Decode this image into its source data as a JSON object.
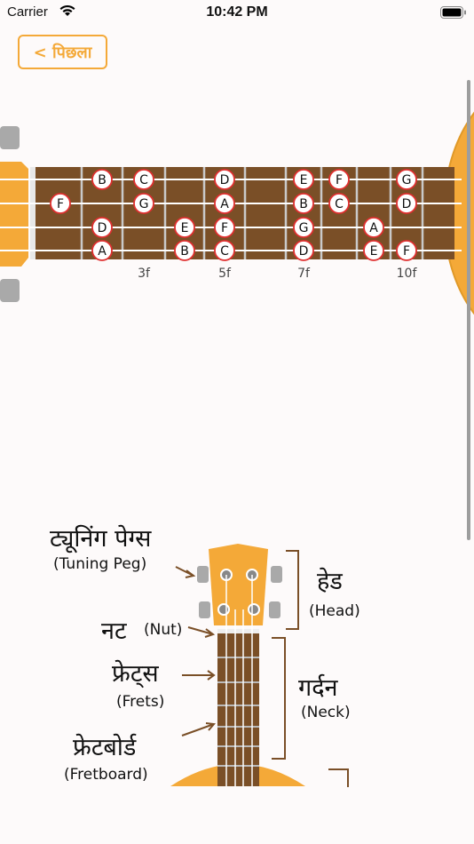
{
  "status_bar": {
    "carrier": "Carrier",
    "time": "10:42 PM"
  },
  "nav": {
    "back_label": "< पिछला"
  },
  "fretboard": {
    "note_markers": [
      {
        "fret": 1,
        "string": 1,
        "label": "B"
      },
      {
        "fret": 2,
        "string": 1,
        "label": "C"
      },
      {
        "fret": 4,
        "string": 1,
        "label": "D"
      },
      {
        "fret": 6,
        "string": 1,
        "label": "E"
      },
      {
        "fret": 7,
        "string": 1,
        "label": "F"
      },
      {
        "fret": 9,
        "string": 1,
        "label": "G"
      },
      {
        "fret": 0,
        "string": 2,
        "label": "F"
      },
      {
        "fret": 2,
        "string": 2,
        "label": "G"
      },
      {
        "fret": 4,
        "string": 2,
        "label": "A"
      },
      {
        "fret": 6,
        "string": 2,
        "label": "B"
      },
      {
        "fret": 7,
        "string": 2,
        "label": "C"
      },
      {
        "fret": 9,
        "string": 2,
        "label": "D"
      },
      {
        "fret": 1,
        "string": 3,
        "label": "D"
      },
      {
        "fret": 3,
        "string": 3,
        "label": "E"
      },
      {
        "fret": 4,
        "string": 3,
        "label": "F"
      },
      {
        "fret": 6,
        "string": 3,
        "label": "G"
      },
      {
        "fret": 8,
        "string": 3,
        "label": "A"
      },
      {
        "fret": 1,
        "string": 4,
        "label": "A"
      },
      {
        "fret": 3,
        "string": 4,
        "label": "B"
      },
      {
        "fret": 4,
        "string": 4,
        "label": "C"
      },
      {
        "fret": 6,
        "string": 4,
        "label": "D"
      },
      {
        "fret": 8,
        "string": 4,
        "label": "E"
      },
      {
        "fret": 9,
        "string": 4,
        "label": "F"
      }
    ],
    "fret_labels": [
      {
        "fret": 2,
        "label": "3f"
      },
      {
        "fret": 4,
        "label": "5f"
      },
      {
        "fret": 6,
        "label": "7f"
      },
      {
        "fret": 9,
        "label": "10f"
      }
    ]
  },
  "diagram": {
    "tuning_peg": "ट्यूनिंग पेग्स",
    "tuning_peg_en": "(Tuning Peg)",
    "nut": "नट",
    "nut_en": "(Nut)",
    "frets": "फ्रेट्स",
    "frets_en": "(Frets)",
    "fretboard": "फ्रेटबोर्ड",
    "fretboard_en": "(Fretboard)",
    "head": "हेड",
    "head_en": "(Head)",
    "neck": "गर्दन",
    "neck_en": "(Neck)"
  },
  "colors": {
    "accent": "#f4a938",
    "wood": "#7a4f27",
    "marker_ring": "#e03030"
  }
}
